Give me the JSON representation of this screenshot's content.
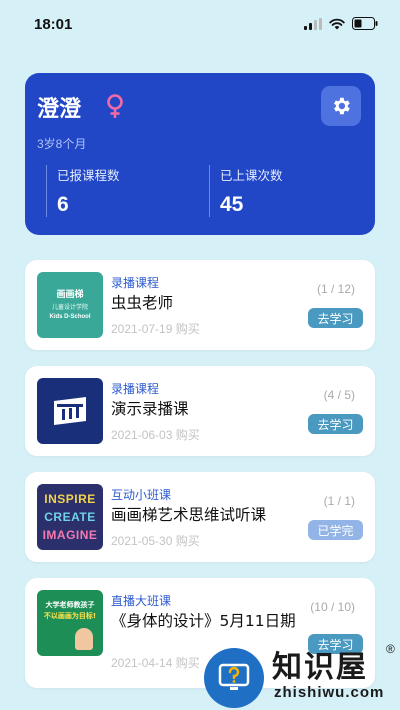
{
  "status_bar": {
    "time": "18:01"
  },
  "profile": {
    "name": "澄澄",
    "age": "3岁8个月",
    "stats": [
      {
        "label": "已报课程数",
        "value": "6"
      },
      {
        "label": "已上课次数",
        "value": "45"
      }
    ]
  },
  "courses": [
    {
      "type": "录播课程",
      "title": "虫虫老师",
      "date": "2021-07-19 购买",
      "progress": "(1 / 12)",
      "button": "去学习",
      "thumb": {
        "name": "画画梯",
        "sub": "儿童设计学院",
        "en": "Kids D-School"
      }
    },
    {
      "type": "录播课程",
      "title": "演示录播课",
      "date": "2021-06-03 购买",
      "progress": "(4 / 5)",
      "button": "去学习"
    },
    {
      "type": "互动小班课",
      "title": "画画梯艺术思维试听课",
      "date": "2021-05-30 购买",
      "progress": "(1 / 1)",
      "button": "已学完",
      "thumb": {
        "lines": [
          "INSPIRE",
          "CREATE",
          "IMAGINE"
        ]
      }
    },
    {
      "type": "直播大班课",
      "title": "《身体的设计》5月11日期",
      "date": "2021-04-14 购买",
      "progress": "(10 / 10)",
      "button": "去学习",
      "thumb": {
        "line1": "大学老师教孩子",
        "line2": "不以画画为目标!"
      }
    }
  ],
  "watermark": {
    "title": "知识屋",
    "domain": "zhishiwu.com",
    "mark": "®"
  },
  "colors": {
    "accent": "#2147c6",
    "button": "#4a99c0",
    "button_done": "#92b4e6",
    "background": "#d6f0f8"
  }
}
